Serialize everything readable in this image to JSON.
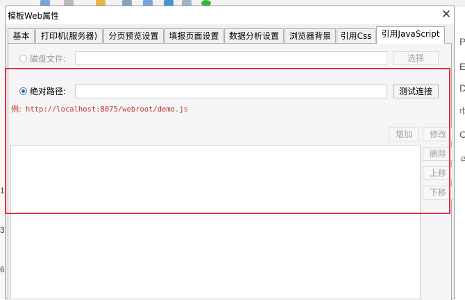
{
  "window": {
    "title": "模板Web属性",
    "close_glyph": "✕"
  },
  "tabs": [
    {
      "label": "基本",
      "active": false
    },
    {
      "label": "打印机(服务器)",
      "active": false
    },
    {
      "label": "分页预览设置",
      "active": false
    },
    {
      "label": "填报页面设置",
      "active": false
    },
    {
      "label": "数据分析设置",
      "active": false
    },
    {
      "label": "浏览器背景",
      "active": false
    },
    {
      "label": "引用Css",
      "active": false
    },
    {
      "label": "引用JavaScript",
      "active": true
    }
  ],
  "disk_file": {
    "label": "磁盘文件:",
    "value": "",
    "selected": false,
    "enabled": false,
    "choose_button": "选择"
  },
  "absolute_path": {
    "label": "绝对路径:",
    "value": "",
    "selected": true,
    "test_button": "测试连接"
  },
  "example_prefix": "例:",
  "example_url": "http://localhost:8075/webroot/demo.js",
  "list_buttons": {
    "add": "增加",
    "edit": "修改",
    "delete": "删除",
    "move_up": "上移",
    "move_down": "下移"
  },
  "background": {
    "right_glyphs": [
      "P",
      "E",
      "D",
      "巾",
      "C",
      "ㄹ"
    ],
    "left_glyphs": [
      "1",
      "3",
      "6"
    ]
  },
  "colors": {
    "highlight": "#e8313d",
    "example_text": "#c0392b",
    "radio_selected": "#2b66c4"
  }
}
